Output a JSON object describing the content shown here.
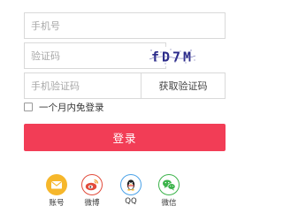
{
  "form": {
    "phone": {
      "placeholder": "手机号",
      "value": ""
    },
    "captcha": {
      "placeholder": "验证码",
      "value": "",
      "image_text": "fD7M"
    },
    "sms": {
      "placeholder": "手机验证码",
      "value": "",
      "button_label": "获取验证码"
    },
    "remember": {
      "label": "一个月内免登录",
      "checked": false
    },
    "login_label": "登录"
  },
  "social": [
    {
      "label": "账号",
      "icon": "envelope-icon",
      "color": "#f6b72b"
    },
    {
      "label": "微博",
      "icon": "weibo-icon",
      "color": "#e24b3b"
    },
    {
      "label": "QQ",
      "icon": "qq-penguin-icon",
      "color": "#4aa2e8"
    },
    {
      "label": "微信",
      "icon": "wechat-icon",
      "color": "#3bb34a"
    }
  ],
  "colors": {
    "primary": "#f23d56",
    "border": "#d9d9d9",
    "captcha_text": "#2b2b8a"
  }
}
